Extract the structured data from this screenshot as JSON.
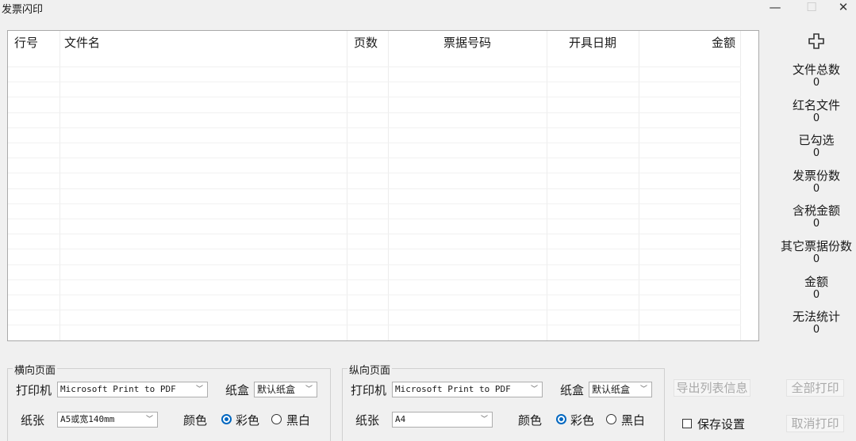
{
  "window": {
    "title": "发票闪印",
    "minimize": "—",
    "maximize": "☐",
    "close": "✕"
  },
  "table": {
    "headers": [
      "行号",
      "文件名",
      "页数",
      "票据号码",
      "开具日期",
      "金额"
    ]
  },
  "stats": [
    {
      "label": "文件总数",
      "value": "0"
    },
    {
      "label": "红名文件",
      "value": "0"
    },
    {
      "label": "已勾选",
      "value": "0"
    },
    {
      "label": "发票份数",
      "value": "0"
    },
    {
      "label": "含税金额",
      "value": "0"
    },
    {
      "label": "其它票据份数",
      "value": "0"
    },
    {
      "label": "金额",
      "value": "0"
    },
    {
      "label": "无法统计",
      "value": "0"
    }
  ],
  "landscape": {
    "group_label": "横向页面",
    "printer_label": "打印机",
    "printer_value": "Microsoft Print to PDF",
    "tray_label": "纸盒",
    "tray_value": "默认纸盒",
    "paper_label": "纸张",
    "paper_value": "A5或宽140mm",
    "color_label": "颜色",
    "color_option": "彩色",
    "bw_option": "黑白"
  },
  "portrait": {
    "group_label": "纵向页面",
    "printer_label": "打印机",
    "printer_value": "Microsoft Print to PDF",
    "tray_label": "纸盒",
    "tray_value": "默认纸盒",
    "paper_label": "纸张",
    "paper_value": "A4",
    "color_label": "颜色",
    "color_option": "彩色",
    "bw_option": "黑白"
  },
  "actions": {
    "export_label": "导出列表信息",
    "print_all_label": "全部打印",
    "save_settings_label": "保存设置",
    "cancel_print_label": "取消打印"
  }
}
